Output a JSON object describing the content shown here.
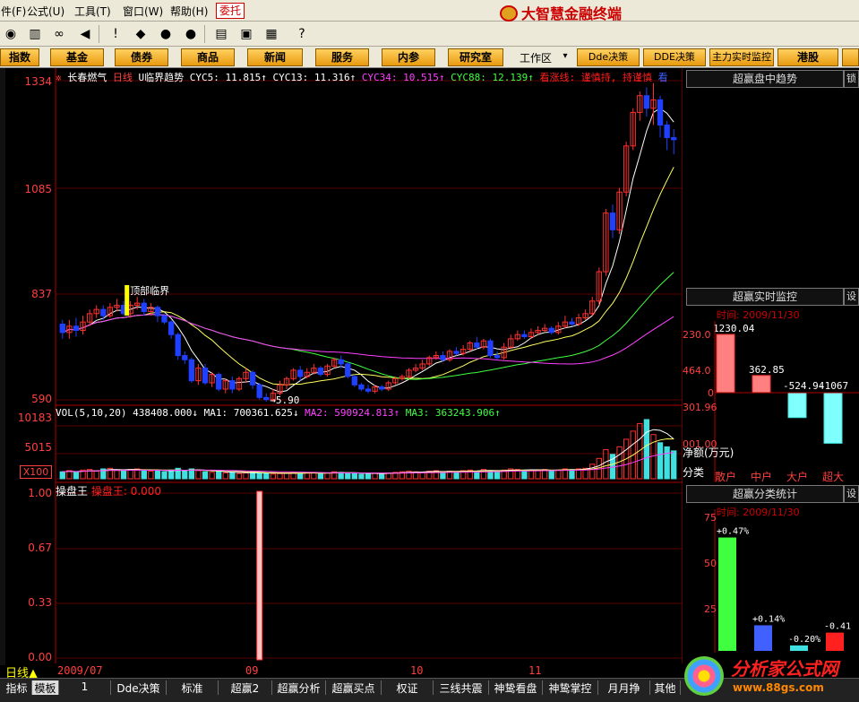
{
  "menu": {
    "items": [
      {
        "label": "件(F)"
      },
      {
        "label": "公式(U)"
      },
      {
        "label": "工具(T)"
      },
      {
        "label": "窗口(W)"
      },
      {
        "label": "帮助(H)"
      }
    ],
    "trade_button": "委托",
    "app_title": "大智慧金融终端"
  },
  "toolbar_icons": [
    "chart-icon",
    "bars-icon",
    "binoculars-icon",
    "speaker-icon",
    "alert-icon",
    "diamond-icon",
    "mark-icon",
    "mark2-icon",
    "note-icon",
    "window-icon",
    "books-icon",
    "help-cursor-icon"
  ],
  "nav": {
    "buttons": [
      "指数",
      "基金",
      "债券",
      "商品",
      "新闻",
      "服务",
      "内参",
      "研究室"
    ],
    "workarea_label": "工作区",
    "right_buttons": [
      "Dde决策",
      "DDE决策",
      "主力实时监控",
      "港股"
    ]
  },
  "chart_header": {
    "stock_name": "长春燃气",
    "period": "日线",
    "indicator": "U临界趋势",
    "cyc5": "CYC5: 11.815↑",
    "cyc13": "CYC13: 11.316↑",
    "cyc34": "CYC34: 10.515↑",
    "cyc88": "CYC88: 12.139↑",
    "signal": "看涨线: 谨慎持, 持谨慎",
    "extra": "看"
  },
  "price_axis": {
    "ticks": [
      "1334",
      "1085",
      "837",
      "590"
    ]
  },
  "annotation": {
    "top_label": "顶部临界",
    "low_label": "5.90"
  },
  "volume_header": {
    "vol": "VOL(5,10,20)  438408.000↓",
    "ma1": "MA1: 700361.625↓",
    "ma2": "MA2: 590924.813↑",
    "ma3": "MA3: 363243.906↑"
  },
  "volume_axis": {
    "ticks": [
      "10183",
      "5015"
    ],
    "unit": "X100"
  },
  "indicator_header": {
    "name": "操盘王",
    "value": "操盘王: 0.000"
  },
  "indicator_axis": {
    "ticks": [
      "1.00",
      "0.67",
      "0.33",
      "0.00"
    ]
  },
  "date_axis": {
    "labels": [
      "2009/07",
      "09",
      "10",
      "11"
    ]
  },
  "period_label": "日线▲",
  "tabs": [
    "指标",
    "模板",
    "1",
    "Dde决策",
    "标准",
    "超赢2",
    "超赢分析",
    "超赢买点",
    "权证",
    "三线共震",
    "神鸷看盘",
    "神鸷掌控",
    "月月挣",
    "其他"
  ],
  "right_panels": {
    "trend": {
      "title": "超赢盘中趋势",
      "side": "锁"
    },
    "monitor": {
      "title": "超赢实时监控",
      "side": "设",
      "time": "时间: 2009/11/30",
      "axis": [
        "230.0",
        "464.0",
        "0",
        "301.96",
        "001.00"
      ],
      "net_label": "净额(万元)",
      "category_label": "分类"
    },
    "stats": {
      "title": "超赢分类统计",
      "side": "设",
      "time": "时间: 2009/11/30",
      "axis": [
        "75",
        "50",
        "25"
      ]
    }
  },
  "watermark": {
    "line1": "分析家公式网",
    "line2": "www.88gs.com"
  },
  "chart_data": {
    "type": "candlestick",
    "price_range": [
      5.9,
      13.6
    ],
    "candles": [
      [
        7.75,
        7.55,
        7.85,
        7.4
      ],
      [
        7.55,
        7.7,
        7.85,
        7.4
      ],
      [
        7.7,
        7.6,
        7.9,
        7.45
      ],
      [
        7.6,
        7.8,
        7.95,
        7.5
      ],
      [
        7.8,
        8.0,
        8.1,
        7.7
      ],
      [
        8.0,
        8.1,
        8.2,
        7.9
      ],
      [
        8.1,
        7.95,
        8.2,
        7.85
      ],
      [
        7.95,
        8.15,
        8.25,
        7.9
      ],
      [
        8.15,
        8.2,
        8.35,
        8.05
      ],
      [
        8.2,
        8.0,
        8.3,
        7.95
      ],
      [
        8.0,
        8.2,
        8.3,
        7.9
      ],
      [
        8.2,
        8.25,
        8.4,
        8.1
      ],
      [
        8.25,
        8.05,
        8.35,
        7.95
      ],
      [
        8.05,
        8.15,
        8.25,
        7.95
      ],
      [
        8.15,
        7.95,
        8.2,
        7.8
      ],
      [
        7.95,
        7.8,
        8.0,
        7.75
      ],
      [
        7.8,
        7.5,
        7.85,
        7.4
      ],
      [
        7.5,
        7.0,
        7.55,
        6.9
      ],
      [
        7.0,
        6.9,
        7.1,
        6.8
      ],
      [
        6.9,
        6.4,
        6.95,
        6.35
      ],
      [
        6.4,
        6.7,
        6.8,
        6.3
      ],
      [
        6.7,
        6.35,
        6.8,
        6.3
      ],
      [
        6.35,
        6.55,
        6.6,
        6.25
      ],
      [
        6.55,
        6.2,
        6.6,
        6.15
      ],
      [
        6.2,
        6.4,
        6.45,
        6.1
      ],
      [
        6.4,
        6.2,
        6.5,
        6.1
      ],
      [
        6.2,
        6.45,
        6.5,
        6.15
      ],
      [
        6.45,
        6.6,
        6.7,
        6.35
      ],
      [
        6.6,
        6.3,
        6.65,
        6.2
      ],
      [
        6.3,
        6.0,
        6.35,
        5.95
      ],
      [
        6.0,
        5.95,
        6.1,
        5.9
      ],
      [
        5.95,
        6.1,
        6.2,
        5.9
      ],
      [
        6.1,
        6.3,
        6.4,
        6.05
      ],
      [
        6.3,
        6.45,
        6.5,
        6.2
      ],
      [
        6.45,
        6.65,
        6.7,
        6.4
      ],
      [
        6.65,
        6.5,
        6.75,
        6.4
      ],
      [
        6.5,
        6.6,
        6.7,
        6.45
      ],
      [
        6.6,
        6.7,
        6.8,
        6.55
      ],
      [
        6.7,
        6.55,
        6.75,
        6.5
      ],
      [
        6.55,
        6.75,
        6.8,
        6.5
      ],
      [
        6.75,
        6.9,
        6.95,
        6.7
      ],
      [
        6.9,
        6.8,
        7.0,
        6.7
      ],
      [
        6.8,
        6.5,
        6.85,
        6.45
      ],
      [
        6.5,
        6.3,
        6.55,
        6.25
      ],
      [
        6.3,
        6.2,
        6.35,
        6.15
      ],
      [
        6.2,
        6.15,
        6.3,
        6.1
      ],
      [
        6.15,
        6.25,
        6.3,
        6.1
      ],
      [
        6.25,
        6.2,
        6.3,
        6.15
      ],
      [
        6.2,
        6.35,
        6.4,
        6.15
      ],
      [
        6.35,
        6.45,
        6.5,
        6.3
      ],
      [
        6.45,
        6.5,
        6.55,
        6.4
      ],
      [
        6.5,
        6.65,
        6.7,
        6.45
      ],
      [
        6.65,
        6.7,
        6.8,
        6.6
      ],
      [
        6.7,
        6.8,
        6.9,
        6.65
      ],
      [
        6.8,
        6.95,
        7.0,
        6.75
      ],
      [
        6.95,
        7.0,
        7.1,
        6.9
      ],
      [
        7.0,
        6.9,
        7.1,
        6.85
      ],
      [
        6.9,
        7.1,
        7.15,
        6.85
      ],
      [
        7.1,
        7.05,
        7.2,
        7.0
      ],
      [
        7.05,
        7.15,
        7.25,
        7.0
      ],
      [
        7.15,
        7.3,
        7.35,
        7.1
      ],
      [
        7.3,
        7.2,
        7.45,
        7.15
      ],
      [
        7.2,
        7.35,
        7.4,
        7.15
      ],
      [
        7.35,
        7.0,
        7.4,
        6.95
      ],
      [
        7.0,
        6.95,
        7.1,
        6.9
      ],
      [
        6.95,
        7.2,
        7.3,
        6.9
      ],
      [
        7.2,
        7.4,
        7.5,
        7.15
      ],
      [
        7.4,
        7.5,
        7.6,
        7.35
      ],
      [
        7.5,
        7.45,
        7.6,
        7.4
      ],
      [
        7.45,
        7.55,
        7.65,
        7.4
      ],
      [
        7.55,
        7.6,
        7.7,
        7.5
      ],
      [
        7.6,
        7.65,
        7.75,
        7.55
      ],
      [
        7.65,
        7.55,
        7.7,
        7.5
      ],
      [
        7.55,
        7.7,
        7.8,
        7.5
      ],
      [
        7.7,
        7.8,
        7.95,
        7.65
      ],
      [
        7.8,
        7.75,
        7.9,
        7.7
      ],
      [
        7.75,
        7.9,
        8.0,
        7.7
      ],
      [
        7.9,
        8.0,
        8.1,
        7.85
      ],
      [
        8.0,
        8.3,
        8.4,
        7.95
      ],
      [
        8.3,
        9.0,
        9.1,
        8.2
      ],
      [
        9.0,
        10.4,
        10.5,
        8.9
      ],
      [
        10.4,
        10.0,
        10.6,
        9.8
      ],
      [
        10.0,
        10.9,
        11.0,
        9.9
      ],
      [
        10.9,
        12.0,
        12.1,
        10.8
      ],
      [
        12.0,
        12.8,
        12.9,
        11.9
      ],
      [
        12.8,
        13.2,
        13.3,
        12.6
      ],
      [
        13.2,
        12.9,
        13.4,
        12.7
      ],
      [
        12.9,
        13.1,
        13.5,
        12.5
      ],
      [
        13.1,
        12.5,
        13.2,
        12.2
      ],
      [
        12.5,
        12.2,
        12.6,
        11.9
      ],
      [
        12.2,
        12.15,
        12.4,
        11.8
      ]
    ],
    "volume_range": [
      0,
      10183
    ],
    "volume": [
      1200,
      1400,
      1100,
      1500,
      1600,
      1300,
      1700,
      1800,
      1500,
      1400,
      1600,
      1700,
      1500,
      1300,
      1400,
      1200,
      1500,
      1800,
      1300,
      1700,
      1400,
      1200,
      1100,
      1300,
      1000,
      1100,
      900,
      1000,
      1200,
      1000,
      900,
      800,
      900,
      1000,
      1100,
      900,
      1000,
      1100,
      900,
      1000,
      1200,
      1100,
      1000,
      900,
      800,
      900,
      1000,
      900,
      1000,
      1100,
      1200,
      1300,
      1200,
      1100,
      1300,
      1400,
      1200,
      1300,
      1200,
      1400,
      1500,
      1300,
      1600,
      1400,
      1200,
      1500,
      1700,
      1600,
      1500,
      1400,
      1500,
      1600,
      1400,
      1500,
      1700,
      1600,
      1700,
      1800,
      2500,
      3500,
      5000,
      4200,
      5500,
      6800,
      8200,
      9500,
      10183,
      7600,
      6200,
      5500,
      4800
    ],
    "indicator_range": [
      0,
      1.0
    ],
    "indicator": [
      {
        "index": 29,
        "value": 1.0
      }
    ],
    "monitor_bars": {
      "categories": [
        "散户",
        "中户",
        "大户",
        "超大"
      ],
      "values": [
        1230.04,
        362.85,
        -524.94,
        -1067
      ],
      "labels": [
        "1230.04",
        "362.85",
        "-524.94",
        "-1067"
      ]
    },
    "stats_bars": {
      "labels": [
        "+0.47%",
        "+0.14%",
        "-0.20%",
        "-0.41"
      ],
      "values": [
        62,
        14,
        3,
        10
      ]
    }
  }
}
